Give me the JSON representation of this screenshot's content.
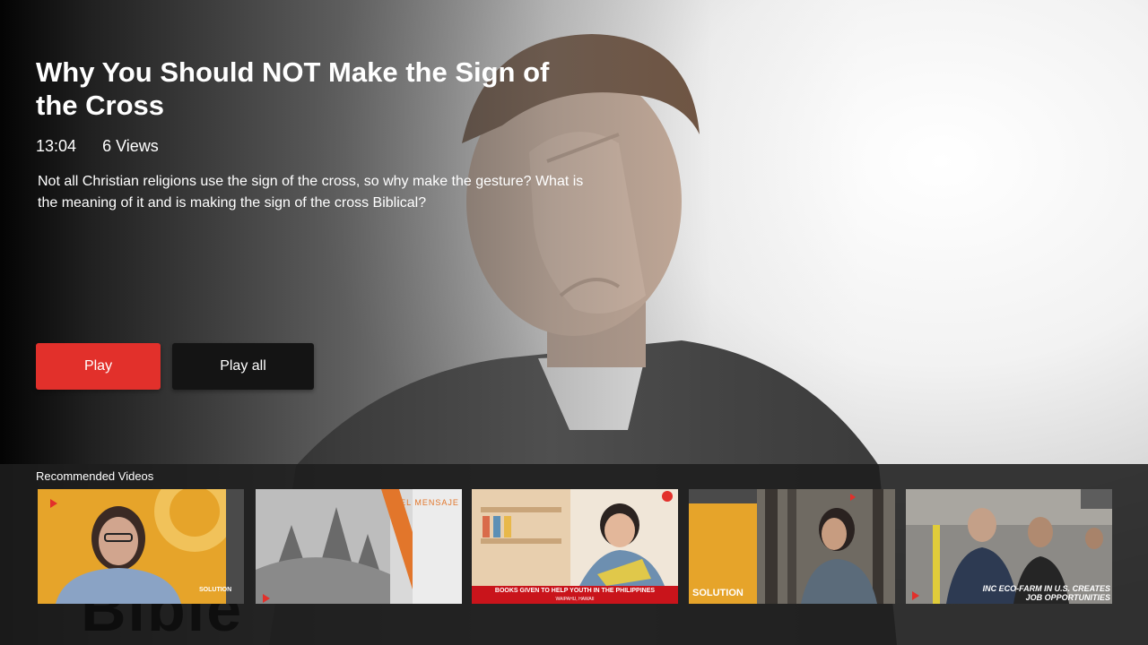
{
  "video": {
    "title": "Why You Should NOT Make the Sign of the Cross",
    "duration": "13:04",
    "views": "6 Views",
    "description": "Not all Christian religions use the sign of the cross, so why make the gesture? What is the meaning of it and is making the sign of the cross Biblical?"
  },
  "actions": {
    "play_label": "Play",
    "play_all_label": "Play all"
  },
  "recommended": {
    "label": "Recommended Videos",
    "items": [
      {
        "brand": "",
        "overlay": "SOLUTION",
        "icon": "play-logo"
      },
      {
        "brand": "EL MENSAJE",
        "overlay": "",
        "icon": "play-logo"
      },
      {
        "brand": "",
        "caption_main": "BOOKS GIVEN TO HELP YOUTH IN THE PHILIPPINES",
        "caption_sub": "WAIPAHU, HAWAII",
        "icon": "inc-logo"
      },
      {
        "brand": "",
        "overlay": "SOLUTION",
        "icon": "play-logo"
      },
      {
        "brand": "",
        "caption_main": "INC ECO-FARM IN U.S. CREATES",
        "caption_sub": "JOB OPPORTUNITIES",
        "icon": "play-logo"
      }
    ]
  },
  "colors": {
    "accent_red": "#e2302b",
    "dark_button": "#141414",
    "text": "#ffffff"
  }
}
